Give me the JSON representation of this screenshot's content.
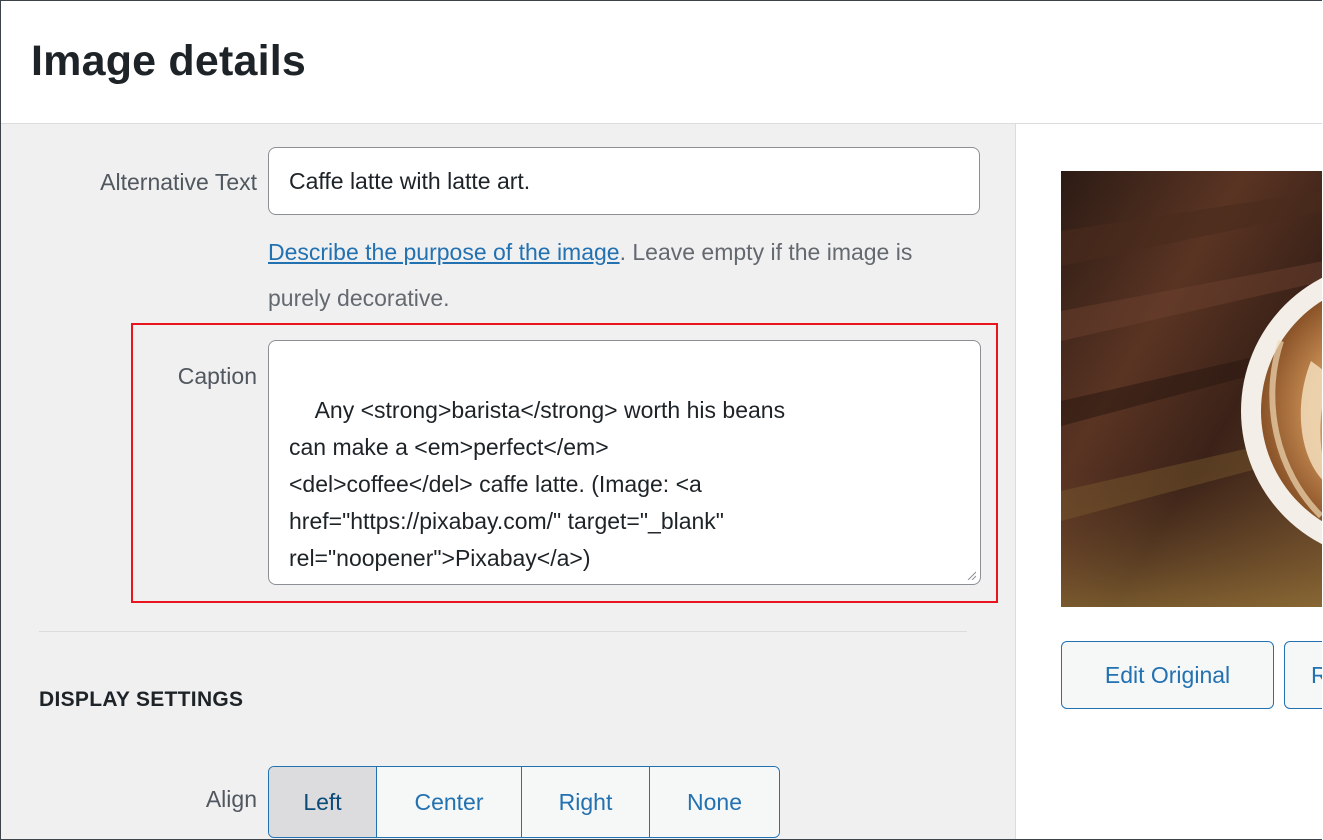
{
  "header": {
    "title": "Image details"
  },
  "attachment": {
    "alt_label": "Alternative Text",
    "alt_value": "Caffe latte with latte art.",
    "help_link": "Describe the purpose of the image",
    "help_rest": ". Leave empty if the image is purely decorative.",
    "caption_label": "Caption",
    "caption_value": "Any <strong>barista</strong> worth his beans\ncan make a <em>perfect</em>\n<del>coffee</del> caffe latte. (Image: <a\nhref=\"https://pixabay.com/\" target=\"_blank\"\nrel=\"noopener\">Pixabay</a>)"
  },
  "display_settings": {
    "heading": "DISPLAY SETTINGS",
    "align_label": "Align",
    "align_options": [
      "Left",
      "Center",
      "Right",
      "None"
    ],
    "align_selected": "Left"
  },
  "preview": {
    "edit_original_label": "Edit Original",
    "replace_label_visible": "R"
  },
  "colors": {
    "accent": "#2271b1",
    "highlight_border": "#e8141e",
    "panel_bg": "#f0f0f1"
  }
}
